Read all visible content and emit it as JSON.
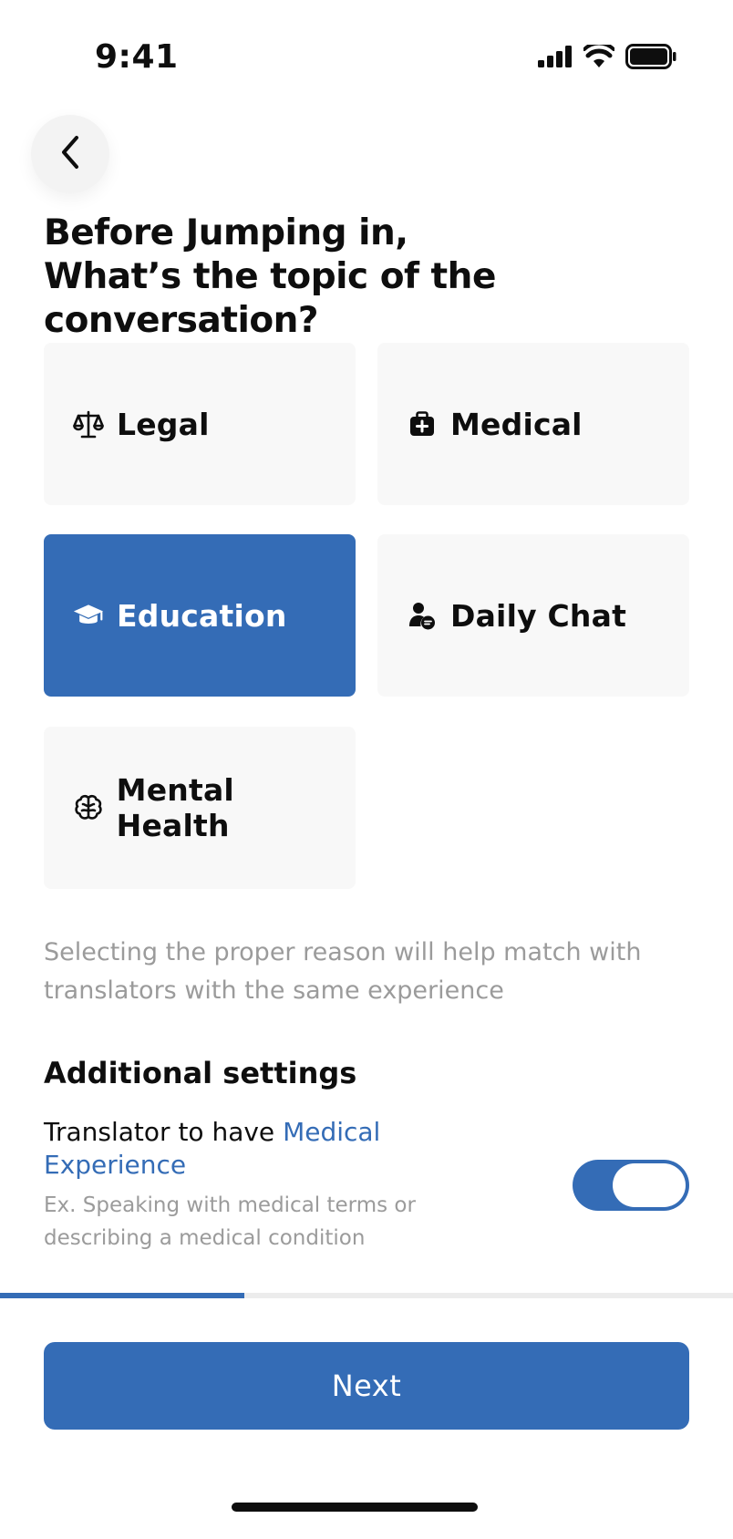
{
  "status_bar": {
    "time": "9:41",
    "icons": [
      "cellular-signal-icon",
      "wifi-icon",
      "battery-icon"
    ]
  },
  "navigation": {
    "back_icon": "chevron-left-icon"
  },
  "header": {
    "title_line1": "Before Jumping in,",
    "title_line2": "What’s the topic of the conversation?"
  },
  "topics": [
    {
      "label": "Legal",
      "icon": "scale-icon",
      "selected": false
    },
    {
      "label": "Medical",
      "icon": "medical-kit-icon",
      "selected": false
    },
    {
      "label": "Education",
      "icon": "graduation-cap-icon",
      "selected": true
    },
    {
      "label": "Daily Chat",
      "icon": "person-chat-icon",
      "selected": false
    },
    {
      "label": "Mental Health",
      "icon": "brain-icon",
      "selected": false
    }
  ],
  "hint": "Selecting the proper reason will help match with translators with the same experience",
  "settings": {
    "heading": "Additional settings",
    "option_prefix": "Translator to have ",
    "option_highlight": "Medical Experience",
    "option_description": "Ex. Speaking with medical terms or describing a medical condition",
    "toggle_on": true
  },
  "progress": {
    "fraction": 0.333
  },
  "footer": {
    "next_label": "Next"
  },
  "colors": {
    "accent": "#346cb6",
    "card_background": "#f8f8f8",
    "muted_text": "#9b9b9b",
    "text": "#0e0e0e"
  }
}
